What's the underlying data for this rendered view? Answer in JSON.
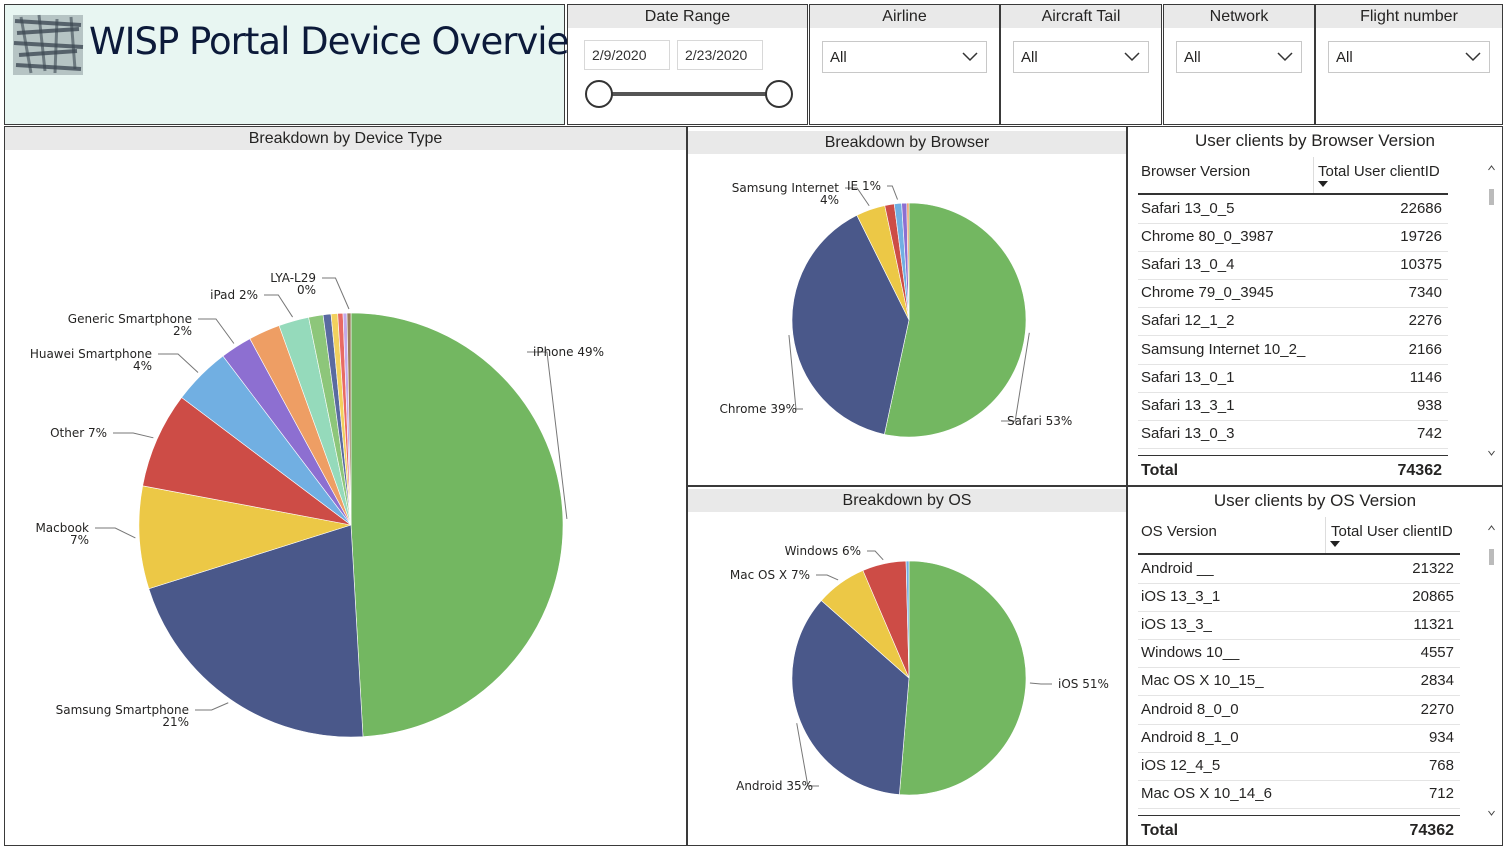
{
  "header": {
    "title": "WISP Portal Device Overview"
  },
  "filters": {
    "date_range": {
      "label": "Date Range",
      "start": "2/9/2020",
      "end": "2/23/2020"
    },
    "airline": {
      "label": "Airline",
      "value": "All"
    },
    "aircraft_tail": {
      "label": "Aircraft Tail",
      "value": "All"
    },
    "network": {
      "label": "Network",
      "value": "All"
    },
    "flight_number": {
      "label": "Flight number",
      "value": "All"
    }
  },
  "colors": {
    "green": "#73b761",
    "navy": "#4a588a",
    "yellow": "#ecc846",
    "red": "#cd4c46",
    "blue": "#71afe2",
    "purple": "#8d6fd1",
    "orange": "#ee9e64",
    "mint": "#95dabb",
    "lightgreen": "#8dc67a",
    "slate": "#5a6aa0",
    "gold": "#f2d15e",
    "coral": "#e86a64",
    "lavender": "#c3a9e8",
    "brown": "#9a7d5a"
  },
  "chart_data": [
    {
      "type": "pie",
      "title": "Breakdown by Device Type",
      "slices": [
        {
          "label": "iPhone",
          "value": 49,
          "color": "#73b761",
          "text": "iPhone 49%"
        },
        {
          "label": "Samsung Smartphone",
          "value": 21,
          "color": "#4a588a",
          "text": "Samsung Smartphone 21%"
        },
        {
          "label": "Macbook",
          "value": 7.8,
          "color": "#ecc846",
          "text": "Macbook 7%"
        },
        {
          "label": "Other",
          "value": 7.3,
          "color": "#cd4c46",
          "text": "Other 7%"
        },
        {
          "label": "Huawei Smartphone",
          "value": 4.4,
          "color": "#71afe2",
          "text": "Huawei Smartphone 4%"
        },
        {
          "label": "Generic Smartphone",
          "value": 2.4,
          "color": "#8d6fd1",
          "text": "Generic Smartphone 2%"
        },
        {
          "label": "",
          "value": 2.4,
          "color": "#ee9e64",
          "text": ""
        },
        {
          "label": "iPad",
          "value": 2.3,
          "color": "#95dabb",
          "text": "iPad 2%"
        },
        {
          "label": "",
          "value": 1.1,
          "color": "#8dc67a",
          "text": ""
        },
        {
          "label": "",
          "value": 0.6,
          "color": "#5a6aa0",
          "text": ""
        },
        {
          "label": "",
          "value": 0.5,
          "color": "#f2d15e",
          "text": ""
        },
        {
          "label": "",
          "value": 0.4,
          "color": "#e86a64",
          "text": ""
        },
        {
          "label": "",
          "value": 0.3,
          "color": "#c3a9e8",
          "text": ""
        },
        {
          "label": "LYA-L29",
          "value": 0.3,
          "color": "#9a7d5a",
          "text": "LYA-L29 0%"
        }
      ]
    },
    {
      "type": "pie",
      "title": "Breakdown by Browser",
      "slices": [
        {
          "label": "Safari",
          "value": 53,
          "color": "#73b761",
          "text": "Safari 53%"
        },
        {
          "label": "Chrome",
          "value": 39,
          "color": "#4a588a",
          "text": "Chrome 39%"
        },
        {
          "label": "Samsung Internet",
          "value": 4,
          "color": "#ecc846",
          "text": "Samsung Internet 4%"
        },
        {
          "label": "",
          "value": 1.3,
          "color": "#cd4c46",
          "text": ""
        },
        {
          "label": "IE",
          "value": 1,
          "color": "#71afe2",
          "text": "IE 1%"
        },
        {
          "label": "",
          "value": 0.7,
          "color": "#8d6fd1",
          "text": ""
        },
        {
          "label": "",
          "value": 0.3,
          "color": "#ee9e64",
          "text": ""
        }
      ]
    },
    {
      "type": "pie",
      "title": "Breakdown by OS",
      "slices": [
        {
          "label": "iOS",
          "value": 51,
          "color": "#73b761",
          "text": "iOS 51%"
        },
        {
          "label": "Android",
          "value": 35,
          "color": "#4a588a",
          "text": "Android 35%"
        },
        {
          "label": "Mac OS X",
          "value": 7,
          "color": "#ecc846",
          "text": "Mac OS X 7%"
        },
        {
          "label": "Windows",
          "value": 6,
          "color": "#cd4c46",
          "text": "Windows 6%"
        },
        {
          "label": "",
          "value": 0.4,
          "color": "#71afe2",
          "text": ""
        }
      ]
    },
    {
      "type": "table",
      "title": "User clients by Browser Version",
      "columns": [
        "Browser Version",
        "Total User clientID"
      ],
      "rows": [
        [
          "Safari 13_0_5",
          22686
        ],
        [
          "Chrome 80_0_3987",
          19726
        ],
        [
          "Safari 13_0_4",
          10375
        ],
        [
          "Chrome 79_0_3945",
          7340
        ],
        [
          "Safari 12_1_2",
          2276
        ],
        [
          "Samsung Internet 10_2_",
          2166
        ],
        [
          "Safari 13_0_1",
          1146
        ],
        [
          "Safari 13_3_1",
          938
        ],
        [
          "Safari 13_0_3",
          742
        ]
      ],
      "total_label": "Total",
      "total": 74362
    },
    {
      "type": "table",
      "title": "User clients by OS Version",
      "columns": [
        "OS Version",
        "Total User clientID"
      ],
      "rows": [
        [
          "Android __",
          21322
        ],
        [
          "iOS 13_3_1",
          20865
        ],
        [
          "iOS 13_3_",
          11321
        ],
        [
          "Windows 10__",
          4557
        ],
        [
          "Mac OS X 10_15_",
          2834
        ],
        [
          "Android 8_0_0",
          2270
        ],
        [
          "Android 8_1_0",
          934
        ],
        [
          "iOS 12_4_5",
          768
        ],
        [
          "Mac OS X 10_14_6",
          712
        ]
      ],
      "total_label": "Total",
      "total": 74362
    }
  ]
}
